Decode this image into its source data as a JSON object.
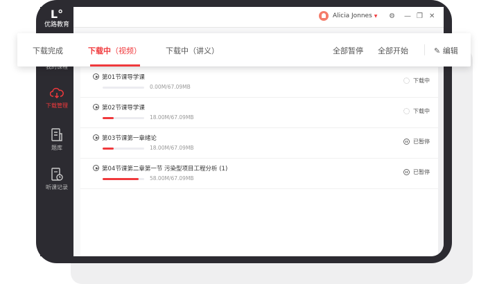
{
  "app": {
    "logo_text": "优路教育"
  },
  "sidebar": {
    "items": [
      {
        "label": "我的课程"
      },
      {
        "label": "下载管理"
      },
      {
        "label": "题库"
      },
      {
        "label": "听课记录"
      }
    ]
  },
  "user": {
    "name": "Alicia Jonnes"
  },
  "tabs": [
    {
      "label": "下载完成"
    },
    {
      "label": "下载中",
      "sub": "（视频）"
    },
    {
      "label": "下载中（讲义）"
    }
  ],
  "actions": {
    "pause_all": "全部暂停",
    "start_all": "全部开始",
    "edit": "编辑"
  },
  "downloads": [
    {
      "title": "第01节课导学课",
      "size": "0.00M/67.09MB",
      "progress": 0,
      "status": "下载中",
      "state": "downloading"
    },
    {
      "title": "第02节课导学课",
      "size": "18.00M/67.09MB",
      "progress": 0.27,
      "status": "下载中",
      "state": "downloading"
    },
    {
      "title": "第03节课第一章绪论",
      "size": "18.00M/67.09MB",
      "progress": 0.27,
      "status": "已暂停",
      "state": "paused"
    },
    {
      "title": "第04节课第二章第一节 污染型项目工程分析 (1)",
      "size": "58.00M/67.09MB",
      "progress": 0.86,
      "status": "已暂停",
      "state": "paused"
    }
  ],
  "colors": {
    "accent": "#f0393c",
    "frame": "#2c2b31"
  }
}
